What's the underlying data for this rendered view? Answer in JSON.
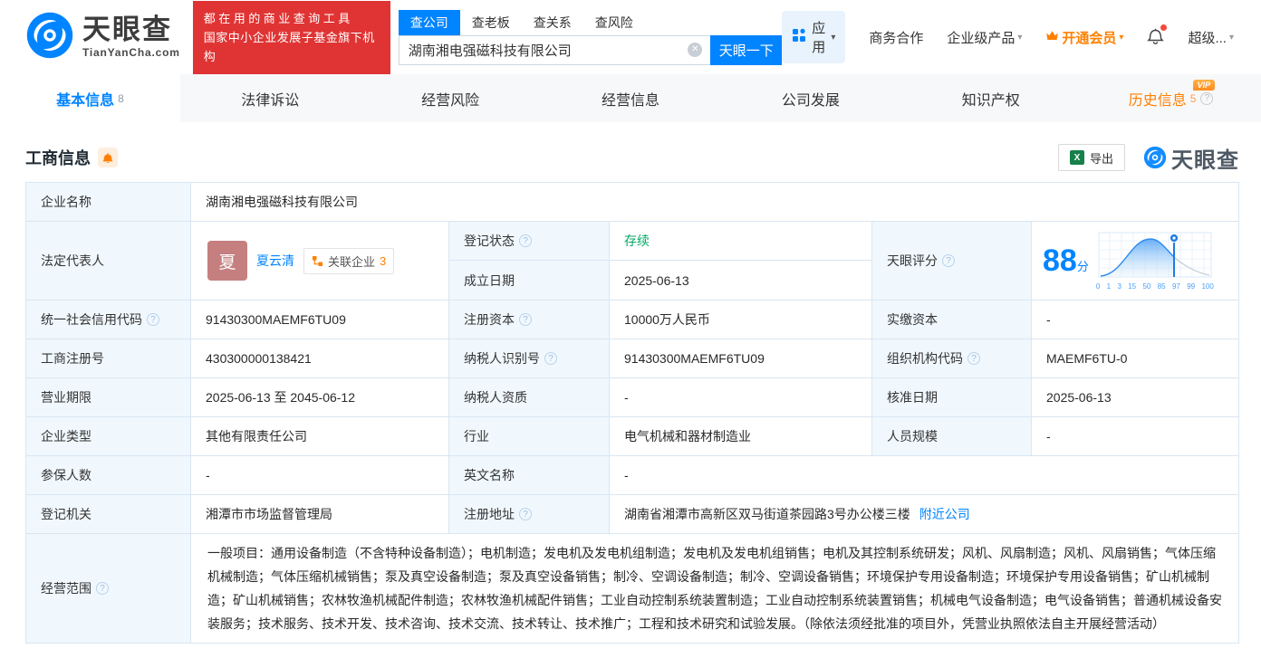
{
  "header": {
    "brand": {
      "name": "天眼查",
      "domain": "TianYanCha.com"
    },
    "slogan": {
      "line1": "都在用的商业查询工具",
      "line2": "国家中小企业发展子基金旗下机构"
    },
    "search": {
      "tabs": [
        {
          "label": "查公司",
          "active": true
        },
        {
          "label": "查老板",
          "active": false
        },
        {
          "label": "查关系",
          "active": false
        },
        {
          "label": "查风险",
          "active": false
        }
      ],
      "value": "湖南湘电强磁科技有限公司",
      "button": "天眼一下"
    },
    "nav": {
      "apps": "应用",
      "cooperation": "商务合作",
      "enterprise": "企业级产品",
      "vip": "开通会员",
      "user": "超级..."
    }
  },
  "tabs": [
    {
      "label": "基本信息",
      "count": "8"
    },
    {
      "label": "法律诉讼"
    },
    {
      "label": "经营风险"
    },
    {
      "label": "经营信息"
    },
    {
      "label": "公司发展"
    },
    {
      "label": "知识产权"
    },
    {
      "label": "历史信息",
      "count": "5",
      "badge": "VIP"
    }
  ],
  "section": {
    "title": "工商信息",
    "export_label": "导出",
    "watermark": "天眼查"
  },
  "fields": {
    "company_name": {
      "label": "企业名称",
      "value": "湖南湘电强磁科技有限公司"
    },
    "legal_rep": {
      "label": "法定代表人",
      "avatar": "夏",
      "name": "夏云清",
      "related_label": "关联企业",
      "related_count": "3"
    },
    "reg_status": {
      "label": "登记状态",
      "value": "存续"
    },
    "establish_date": {
      "label": "成立日期",
      "value": "2025-06-13"
    },
    "credit_code": {
      "label": "统一社会信用代码",
      "value": "91430300MAEMF6TU09"
    },
    "reg_capital": {
      "label": "注册资本",
      "value": "10000万人民币"
    },
    "paid_capital": {
      "label": "实缴资本",
      "value": "-"
    },
    "reg_number": {
      "label": "工商注册号",
      "value": "430300000138421"
    },
    "taxpayer_id": {
      "label": "纳税人识别号",
      "value": "91430300MAEMF6TU09"
    },
    "org_code": {
      "label": "组织机构代码",
      "value": "MAEMF6TU-0"
    },
    "business_term": {
      "label": "营业期限",
      "value": "2025-06-13 至 2045-06-12"
    },
    "taxpayer_quality": {
      "label": "纳税人资质",
      "value": "-"
    },
    "approval_date": {
      "label": "核准日期",
      "value": "2025-06-13"
    },
    "company_type": {
      "label": "企业类型",
      "value": "其他有限责任公司"
    },
    "industry": {
      "label": "行业",
      "value": "电气机械和器材制造业"
    },
    "staff_size": {
      "label": "人员规模",
      "value": "-"
    },
    "insured_count": {
      "label": "参保人数",
      "value": "-"
    },
    "english_name": {
      "label": "英文名称",
      "value": "-"
    },
    "reg_authority": {
      "label": "登记机关",
      "value": "湘潭市市场监督管理局"
    },
    "reg_address": {
      "label": "注册地址",
      "value": "湖南省湘潭市高新区双马街道茶园路3号办公楼三楼",
      "link": "附近公司"
    },
    "business_scope": {
      "label": "经营范围",
      "value": "一般项目：通用设备制造（不含特种设备制造）；电机制造；发电机及发电机组制造；发电机及发电机组销售；电机及其控制系统研发；风机、风扇制造；风机、风扇销售；气体压缩机械制造；气体压缩机械销售；泵及真空设备制造；泵及真空设备销售；制冷、空调设备制造；制冷、空调设备销售；环境保护专用设备制造；环境保护专用设备销售；矿山机械制造；矿山机械销售；农林牧渔机械配件制造；农林牧渔机械配件销售；工业自动控制系统装置制造；工业自动控制系统装置销售；机械电气设备制造；电气设备销售；普通机械设备安装服务；技术服务、技术开发、技术咨询、技术交流、技术转让、技术推广；工程和技术研究和试验发展。（除依法须经批准的项目外，凭营业执照依法自主开展经营活动）"
    }
  },
  "score": {
    "label": "天眼评分",
    "value": "88",
    "unit": "分",
    "axis": [
      "0",
      "1",
      "3",
      "15",
      "50",
      "85",
      "97",
      "99",
      "100"
    ]
  },
  "icons": {
    "clear": "✕",
    "help": "?",
    "caret": "▾",
    "excel": "X"
  },
  "colors": {
    "accent": "#0084ff",
    "orange": "#ff8000",
    "green": "#00a865",
    "banner_red": "#e03434",
    "label_bg": "#f0f8fe"
  }
}
